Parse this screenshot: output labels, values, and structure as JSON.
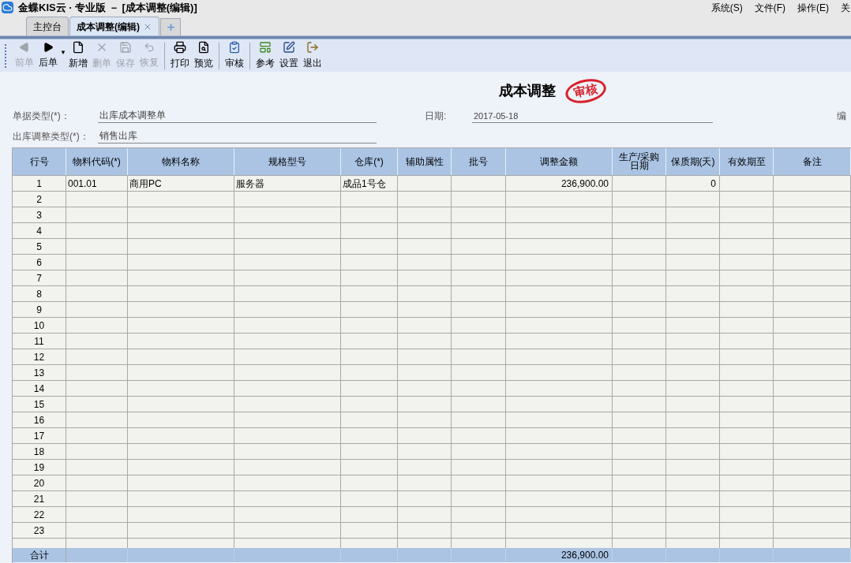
{
  "window": {
    "title": "金蝶KIS云 · 专业版 － [成本调整(编辑)]"
  },
  "menu": [
    "系统(S)",
    "文件(F)",
    "操作(E)",
    "关"
  ],
  "tabs": [
    {
      "label": "主控台",
      "selected": false,
      "closable": false
    },
    {
      "label": "成本调整(编辑)",
      "selected": true,
      "closable": true
    }
  ],
  "toolbar": [
    [
      {
        "label": "前单",
        "disabled": true
      },
      {
        "label": "后单",
        "disabled": false,
        "dropdown": "▼"
      },
      {
        "label": "新增",
        "disabled": false
      },
      {
        "label": "删单",
        "disabled": true
      },
      {
        "label": "保存",
        "disabled": true
      },
      {
        "label": "恢复",
        "disabled": true
      }
    ],
    [
      {
        "label": "打印",
        "disabled": false
      },
      {
        "label": "预览",
        "disabled": false
      }
    ],
    [
      {
        "label": "审核",
        "disabled": false
      }
    ],
    [
      {
        "label": "参考",
        "disabled": false
      },
      {
        "label": "设置",
        "disabled": false
      },
      {
        "label": "退出",
        "disabled": false
      }
    ]
  ],
  "form": {
    "title": "成本调整",
    "stamp": "审核",
    "fields": [
      {
        "label": "单据类型(*)：",
        "value": "出库成本调整单"
      },
      {
        "label": "日期:",
        "value": "2017-05-18"
      },
      {
        "label": "编"
      },
      {
        "label": "出库调整类型(*)：",
        "value": "销售出库"
      }
    ]
  },
  "table": {
    "columns": [
      {
        "label": "行号"
      },
      {
        "label": "物料代码(*)"
      },
      {
        "label": "物料名称"
      },
      {
        "label": "规格型号"
      },
      {
        "label": "仓库(*)"
      },
      {
        "label": "辅助属性"
      },
      {
        "label": "批号"
      },
      {
        "label": "调整金额"
      },
      {
        "label": "生产/采购日期"
      },
      {
        "label": "保质期(天)"
      },
      {
        "label": "有效期至"
      },
      {
        "label": "备注"
      }
    ],
    "rows": [
      {
        "cells": [
          "1",
          "001.01",
          "商用PC",
          "服务器",
          "成品1号仓",
          "",
          "",
          "236,900.00",
          "",
          "0",
          "",
          ""
        ]
      },
      {
        "cells": [
          "2"
        ]
      },
      {
        "cells": [
          "3"
        ]
      },
      {
        "cells": [
          "4"
        ]
      },
      {
        "cells": [
          "5"
        ]
      },
      {
        "cells": [
          "6"
        ]
      },
      {
        "cells": [
          "7"
        ]
      },
      {
        "cells": [
          "8"
        ]
      },
      {
        "cells": [
          "9"
        ]
      },
      {
        "cells": [
          "10"
        ]
      },
      {
        "cells": [
          "11"
        ]
      },
      {
        "cells": [
          "12"
        ]
      },
      {
        "cells": [
          "13"
        ]
      },
      {
        "cells": [
          "14"
        ]
      },
      {
        "cells": [
          "15"
        ]
      },
      {
        "cells": [
          "16"
        ]
      },
      {
        "cells": [
          "17"
        ]
      },
      {
        "cells": [
          "18"
        ]
      },
      {
        "cells": [
          "19"
        ]
      },
      {
        "cells": [
          "20"
        ]
      },
      {
        "cells": [
          "21"
        ]
      },
      {
        "cells": [
          "22"
        ]
      },
      {
        "cells": [
          "23"
        ]
      }
    ],
    "total": {
      "label": "合计",
      "amount": "236,900.00"
    }
  }
}
